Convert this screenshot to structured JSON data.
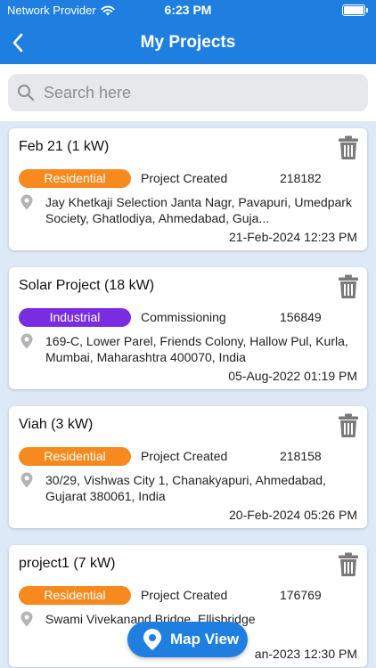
{
  "status_bar": {
    "provider": "Network Provider",
    "time": "6:23 PM"
  },
  "header": {
    "title": "My Projects"
  },
  "search": {
    "placeholder": "Search here",
    "value": ""
  },
  "colors": {
    "header": "#1f7fe0",
    "residential": "#f78a1e",
    "industrial": "#7a2de0",
    "background": "#dde9f7"
  },
  "projects": [
    {
      "name": "Feb 21 (1 kW)",
      "type": "Residential",
      "status": "Project Created",
      "id": "218182",
      "address": "Jay Khetkaji Selection Janta Nagr, Pavapuri, Umedpark Society, Ghatlodiya, Ahmedabad, Guja...",
      "date": "21-Feb-2024 12:23 PM"
    },
    {
      "name": "Solar Project (18 kW)",
      "type": "Industrial",
      "status": "Commissioning",
      "id": "156849",
      "address": "169-C, Lower Parel, Friends Colony, Hallow Pul, Kurla, Mumbai, Maharashtra 400070, India",
      "date": "05-Aug-2022 01:19 PM"
    },
    {
      "name": "Viah (3 kW)",
      "type": "Residential",
      "status": "Project Created",
      "id": "218158",
      "address": "30/29, Vishwas City 1, Chanakyapuri, Ahmedabad, Gujarat 380061, India",
      "date": "20-Feb-2024 05:26 PM"
    },
    {
      "name": "project1 (7 kW)",
      "type": "Residential",
      "status": "Project Created",
      "id": "176769",
      "address": "Swami Vivekanand Bridge, Ellisbridge",
      "date": "an-2023 12:30 PM"
    }
  ],
  "map_button": {
    "label": "Map View"
  }
}
